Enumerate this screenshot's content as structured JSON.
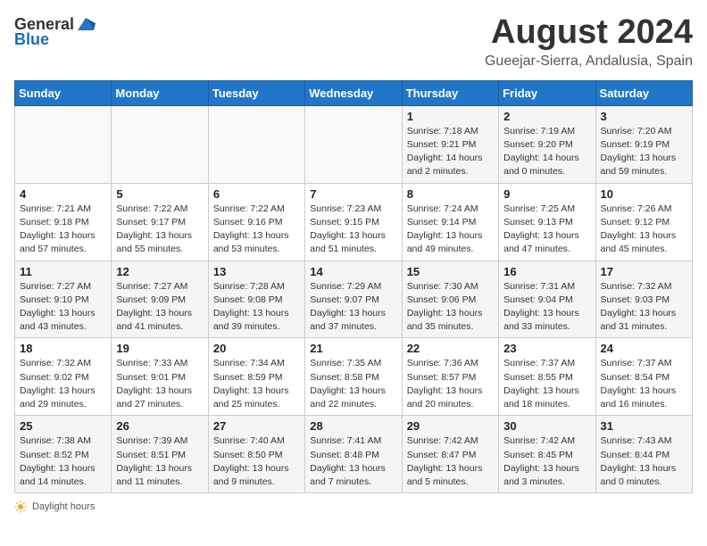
{
  "header": {
    "logo": {
      "general": "General",
      "blue": "Blue"
    },
    "title": "August 2024",
    "subtitle": "Gueejar-Sierra, Andalusia, Spain"
  },
  "calendar": {
    "weekdays": [
      "Sunday",
      "Monday",
      "Tuesday",
      "Wednesday",
      "Thursday",
      "Friday",
      "Saturday"
    ],
    "weeks": [
      [
        {
          "day": "",
          "info": ""
        },
        {
          "day": "",
          "info": ""
        },
        {
          "day": "",
          "info": ""
        },
        {
          "day": "",
          "info": ""
        },
        {
          "day": "1",
          "info": "Sunrise: 7:18 AM\nSunset: 9:21 PM\nDaylight: 14 hours\nand 2 minutes."
        },
        {
          "day": "2",
          "info": "Sunrise: 7:19 AM\nSunset: 9:20 PM\nDaylight: 14 hours\nand 0 minutes."
        },
        {
          "day": "3",
          "info": "Sunrise: 7:20 AM\nSunset: 9:19 PM\nDaylight: 13 hours\nand 59 minutes."
        }
      ],
      [
        {
          "day": "4",
          "info": "Sunrise: 7:21 AM\nSunset: 9:18 PM\nDaylight: 13 hours\nand 57 minutes."
        },
        {
          "day": "5",
          "info": "Sunrise: 7:22 AM\nSunset: 9:17 PM\nDaylight: 13 hours\nand 55 minutes."
        },
        {
          "day": "6",
          "info": "Sunrise: 7:22 AM\nSunset: 9:16 PM\nDaylight: 13 hours\nand 53 minutes."
        },
        {
          "day": "7",
          "info": "Sunrise: 7:23 AM\nSunset: 9:15 PM\nDaylight: 13 hours\nand 51 minutes."
        },
        {
          "day": "8",
          "info": "Sunrise: 7:24 AM\nSunset: 9:14 PM\nDaylight: 13 hours\nand 49 minutes."
        },
        {
          "day": "9",
          "info": "Sunrise: 7:25 AM\nSunset: 9:13 PM\nDaylight: 13 hours\nand 47 minutes."
        },
        {
          "day": "10",
          "info": "Sunrise: 7:26 AM\nSunset: 9:12 PM\nDaylight: 13 hours\nand 45 minutes."
        }
      ],
      [
        {
          "day": "11",
          "info": "Sunrise: 7:27 AM\nSunset: 9:10 PM\nDaylight: 13 hours\nand 43 minutes."
        },
        {
          "day": "12",
          "info": "Sunrise: 7:27 AM\nSunset: 9:09 PM\nDaylight: 13 hours\nand 41 minutes."
        },
        {
          "day": "13",
          "info": "Sunrise: 7:28 AM\nSunset: 9:08 PM\nDaylight: 13 hours\nand 39 minutes."
        },
        {
          "day": "14",
          "info": "Sunrise: 7:29 AM\nSunset: 9:07 PM\nDaylight: 13 hours\nand 37 minutes."
        },
        {
          "day": "15",
          "info": "Sunrise: 7:30 AM\nSunset: 9:06 PM\nDaylight: 13 hours\nand 35 minutes."
        },
        {
          "day": "16",
          "info": "Sunrise: 7:31 AM\nSunset: 9:04 PM\nDaylight: 13 hours\nand 33 minutes."
        },
        {
          "day": "17",
          "info": "Sunrise: 7:32 AM\nSunset: 9:03 PM\nDaylight: 13 hours\nand 31 minutes."
        }
      ],
      [
        {
          "day": "18",
          "info": "Sunrise: 7:32 AM\nSunset: 9:02 PM\nDaylight: 13 hours\nand 29 minutes."
        },
        {
          "day": "19",
          "info": "Sunrise: 7:33 AM\nSunset: 9:01 PM\nDaylight: 13 hours\nand 27 minutes."
        },
        {
          "day": "20",
          "info": "Sunrise: 7:34 AM\nSunset: 8:59 PM\nDaylight: 13 hours\nand 25 minutes."
        },
        {
          "day": "21",
          "info": "Sunrise: 7:35 AM\nSunset: 8:58 PM\nDaylight: 13 hours\nand 22 minutes."
        },
        {
          "day": "22",
          "info": "Sunrise: 7:36 AM\nSunset: 8:57 PM\nDaylight: 13 hours\nand 20 minutes."
        },
        {
          "day": "23",
          "info": "Sunrise: 7:37 AM\nSunset: 8:55 PM\nDaylight: 13 hours\nand 18 minutes."
        },
        {
          "day": "24",
          "info": "Sunrise: 7:37 AM\nSunset: 8:54 PM\nDaylight: 13 hours\nand 16 minutes."
        }
      ],
      [
        {
          "day": "25",
          "info": "Sunrise: 7:38 AM\nSunset: 8:52 PM\nDaylight: 13 hours\nand 14 minutes."
        },
        {
          "day": "26",
          "info": "Sunrise: 7:39 AM\nSunset: 8:51 PM\nDaylight: 13 hours\nand 11 minutes."
        },
        {
          "day": "27",
          "info": "Sunrise: 7:40 AM\nSunset: 8:50 PM\nDaylight: 13 hours\nand 9 minutes."
        },
        {
          "day": "28",
          "info": "Sunrise: 7:41 AM\nSunset: 8:48 PM\nDaylight: 13 hours\nand 7 minutes."
        },
        {
          "day": "29",
          "info": "Sunrise: 7:42 AM\nSunset: 8:47 PM\nDaylight: 13 hours\nand 5 minutes."
        },
        {
          "day": "30",
          "info": "Sunrise: 7:42 AM\nSunset: 8:45 PM\nDaylight: 13 hours\nand 3 minutes."
        },
        {
          "day": "31",
          "info": "Sunrise: 7:43 AM\nSunset: 8:44 PM\nDaylight: 13 hours\nand 0 minutes."
        }
      ]
    ]
  },
  "footer": {
    "daylight_label": "Daylight hours"
  }
}
